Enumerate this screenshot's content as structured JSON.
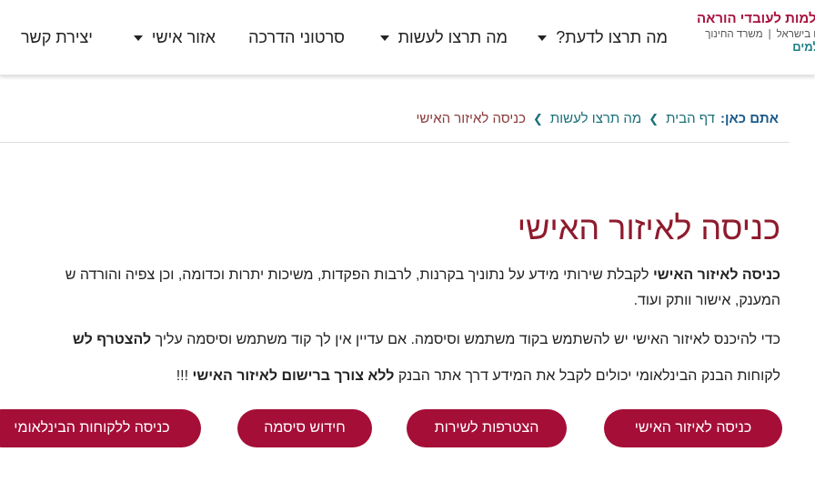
{
  "header": {
    "logo": {
      "line1": "תלמות לעובדי הוראה",
      "line2a": "ורים בישראל",
      "line2b": "משרד החינוך",
      "line3": "תלמים"
    },
    "nav": [
      {
        "label": "מה תרצו לדעת?",
        "has_dropdown": true
      },
      {
        "label": "מה תרצו לעשות",
        "has_dropdown": true
      },
      {
        "label": "סרטוני הדרכה",
        "has_dropdown": false
      },
      {
        "label": "אזור אישי",
        "has_dropdown": true
      },
      {
        "label": "יצירת קשר",
        "has_dropdown": false
      }
    ]
  },
  "breadcrumb": {
    "you_are_here": "אתם כאן:",
    "items": [
      "דף הבית",
      "מה תרצו לעשות",
      "כניסה לאיזור האישי"
    ]
  },
  "main": {
    "title": "כניסה לאיזור האישי",
    "p1_bold": "כניסה לאיזור האישי",
    "p1_rest": " לקבלת שירותי מידע על נתוניך בקרנות, לרבות הפקדות, משיכות יתרות וכדומה, וכן צפיה והורדה ש",
    "p1_line2": "המענק, אישור וותק ועוד.",
    "p2_text": "כדי להיכנס לאיזור האישי יש להשתמש בקוד משתמש וסיסמה. אם עדיין אין לך קוד משתמש וסיסמה עליך ",
    "p2_bold": "להצטרף לש",
    "p3_text": "לקוחות הבנק הבינלאומי יכולים לקבל את המידע דרך אתר הבנק ",
    "p3_bold": "ללא צורך ברישום לאיזור האישי",
    "p3_tail": " !!!"
  },
  "buttons": {
    "personal_area": "כניסה לאיזור האישי",
    "join_service": "הצטרפות לשירות",
    "reset_password": "חידוש סיסמה",
    "international_clients": "כניסה ללקוחות הבינלאומי"
  },
  "colors": {
    "brand": "#a50e37",
    "title": "#8e1b2d",
    "link": "#1b6f7a"
  }
}
